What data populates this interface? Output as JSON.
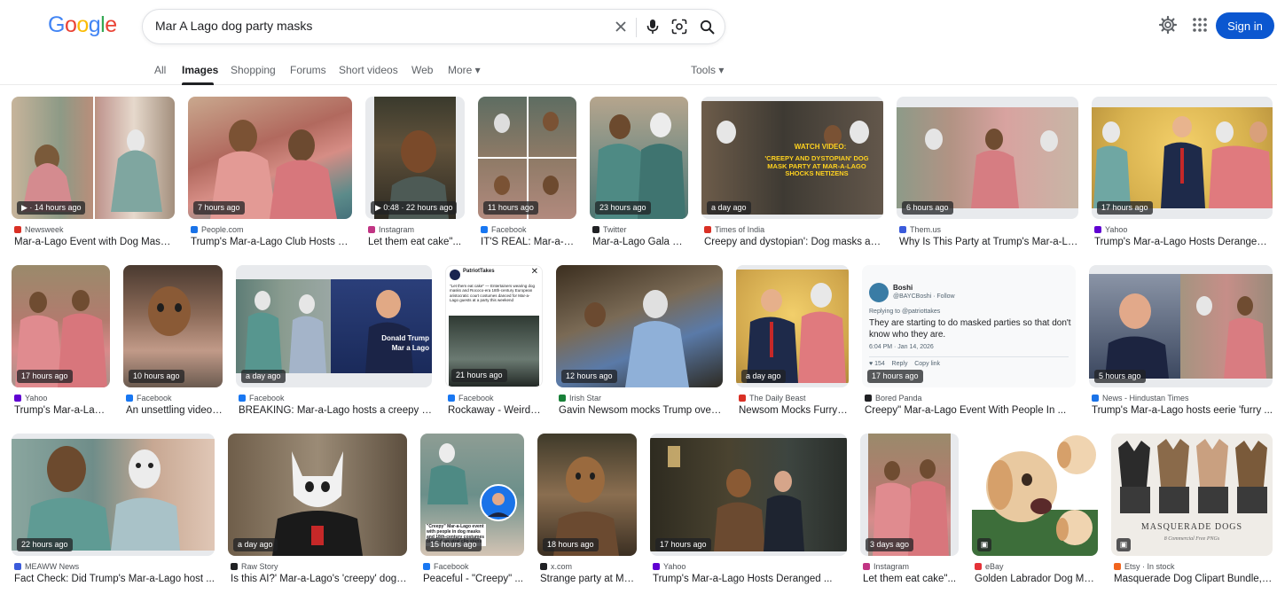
{
  "header": {
    "logo": [
      "G",
      "o",
      "o",
      "g",
      "l",
      "e"
    ],
    "logo_colors": [
      "#4285f4",
      "#ea4335",
      "#fbbc05",
      "#4285f4",
      "#34a853",
      "#ea4335"
    ],
    "search_value": "Mar A Lago dog party masks",
    "signin_label": "Sign in"
  },
  "tabs": [
    "All",
    "Images",
    "Shopping",
    "Forums",
    "Short videos",
    "Web",
    "More ▾",
    "Tools ▾"
  ],
  "results": [
    {
      "badge": "▶ · 14 hours ago",
      "source": "Newsweek",
      "fav": "#d93025",
      "title": "Mar-a-Lago Event with Dog Masks ..."
    },
    {
      "badge": "7 hours ago",
      "source": "People.com",
      "fav": "#1a73e8",
      "title": "Trump's Mar-a-Lago Club Hosts Ga..."
    },
    {
      "badge": "▶ 0:48 · 22 hours ago",
      "source": "Instagram",
      "fav": "#c13584",
      "title": "Let them eat cake\"..."
    },
    {
      "badge": "11 hours ago",
      "source": "Facebook",
      "fav": "#1877f2",
      "title": "IT'S REAL: Mar-a-La..."
    },
    {
      "badge": "23 hours ago",
      "source": "Twitter",
      "fav": "#202124",
      "title": "Mar-a-Lago Gala Fe..."
    },
    {
      "badge": "a day ago",
      "source": "Times of India",
      "fav": "#d93025",
      "title": "Creepy and dystopian': Dog masks and..."
    },
    {
      "badge": "6 hours ago",
      "source": "Them.us",
      "fav": "#3b5bdb",
      "title": "Why Is This Party at Trump's Mar-a-La..."
    },
    {
      "badge": "17 hours ago",
      "source": "Yahoo",
      "fav": "#6001d2",
      "title": "Trump's Mar-a-Lago Hosts Deranged ..."
    },
    {
      "badge": "17 hours ago",
      "source": "Yahoo",
      "fav": "#6001d2",
      "title": "Trump's Mar-a-Lago..."
    },
    {
      "badge": "10 hours ago",
      "source": "Facebook",
      "fav": "#1877f2",
      "title": "An unsettling video ..."
    },
    {
      "badge": "a day ago",
      "source": "Facebook",
      "fav": "#1877f2",
      "title": "BREAKING: Mar-a-Lago hosts a creepy do..."
    },
    {
      "badge": "21 hours ago",
      "source": "Facebook",
      "fav": "#1877f2",
      "title": "Rockaway - Weird: ..."
    },
    {
      "badge": "12 hours ago",
      "source": "Irish Star",
      "fav": "#188038",
      "title": "Gavin Newsom mocks Trump over ..."
    },
    {
      "badge": "a day ago",
      "source": "The Daily Beast",
      "fav": "#d93025",
      "title": "Newsom Mocks Furry-..."
    },
    {
      "badge": "17 hours ago",
      "source": "Bored Panda",
      "fav": "#202124",
      "title": "Creepy\" Mar-a-Lago Event With People In ..."
    },
    {
      "badge": "5 hours ago",
      "source": "News - Hindustan Times",
      "fav": "#1a73e8",
      "title": "Trump's Mar-a-Lago hosts eerie 'furry ..."
    },
    {
      "badge": "22 hours ago",
      "source": "MEAWW News",
      "fav": "#3b5bdb",
      "title": "Fact Check: Did Trump's Mar-a-Lago host ..."
    },
    {
      "badge": "a day ago",
      "source": "Raw Story",
      "fav": "#202124",
      "title": "Is this AI?' Mar-a-Lago's 'creepy' dog ..."
    },
    {
      "badge": "15 hours ago",
      "source": "Facebook",
      "fav": "#1877f2",
      "title": "Peaceful - \"Creepy\" ..."
    },
    {
      "badge": "18 hours ago",
      "source": "x.com",
      "fav": "#202124",
      "title": "Strange party at Ma..."
    },
    {
      "badge": "17 hours ago",
      "source": "Yahoo",
      "fav": "#6001d2",
      "title": "Trump's Mar-a-Lago Hosts Deranged ..."
    },
    {
      "badge": "3 days ago",
      "source": "Instagram",
      "fav": "#c13584",
      "title": "Let them eat cake\"..."
    },
    {
      "badge": "▣",
      "source": "eBay",
      "fav": "#e53238",
      "title": "Golden Labrador Dog Mas..."
    },
    {
      "badge": "▣",
      "source": "Etsy · In stock",
      "fav": "#f1641e",
      "title": "Masquerade Dog Clipart Bundle, ..."
    }
  ],
  "overlays": {
    "watch_video": "WATCH VIDEO:",
    "toi_headline": "'CREEPY AND DYSTOPIAN' DOG MASK PARTY AT MAR-A-LAGO SHOCKS NETIZENS",
    "donald": "Donald Trump",
    "maralago": "Mar a Lago",
    "tweet_user": "Boshi",
    "tweet_handle": "@BAYCBoshi · Follow",
    "tweet_reply": "Replying to @patriottakes",
    "tweet_text": "They are starting to do masked parties so that don't know who they are.",
    "tweet_time": "6:04 PM · Jan 14, 2026",
    "tweet_actions": "♥ 154    Reply    Copy link",
    "pt_name": "PatriotTakes",
    "pt_text": "\"Let them eat cake\" — Entertainers wearing dog masks and Rococo-era 18th-century European aristocratic court costumes danced for Mar-a-Lago guests at a party this weekend",
    "creepy_caption": "\"Creepy\" Mar-a-Lago event with people in dog masks and 18th-century costumes blasted, as viral clip stuns",
    "masquerade": "MASQUERADE DOGS",
    "masquerade_sub": "8 Commercial Free PNGs"
  }
}
